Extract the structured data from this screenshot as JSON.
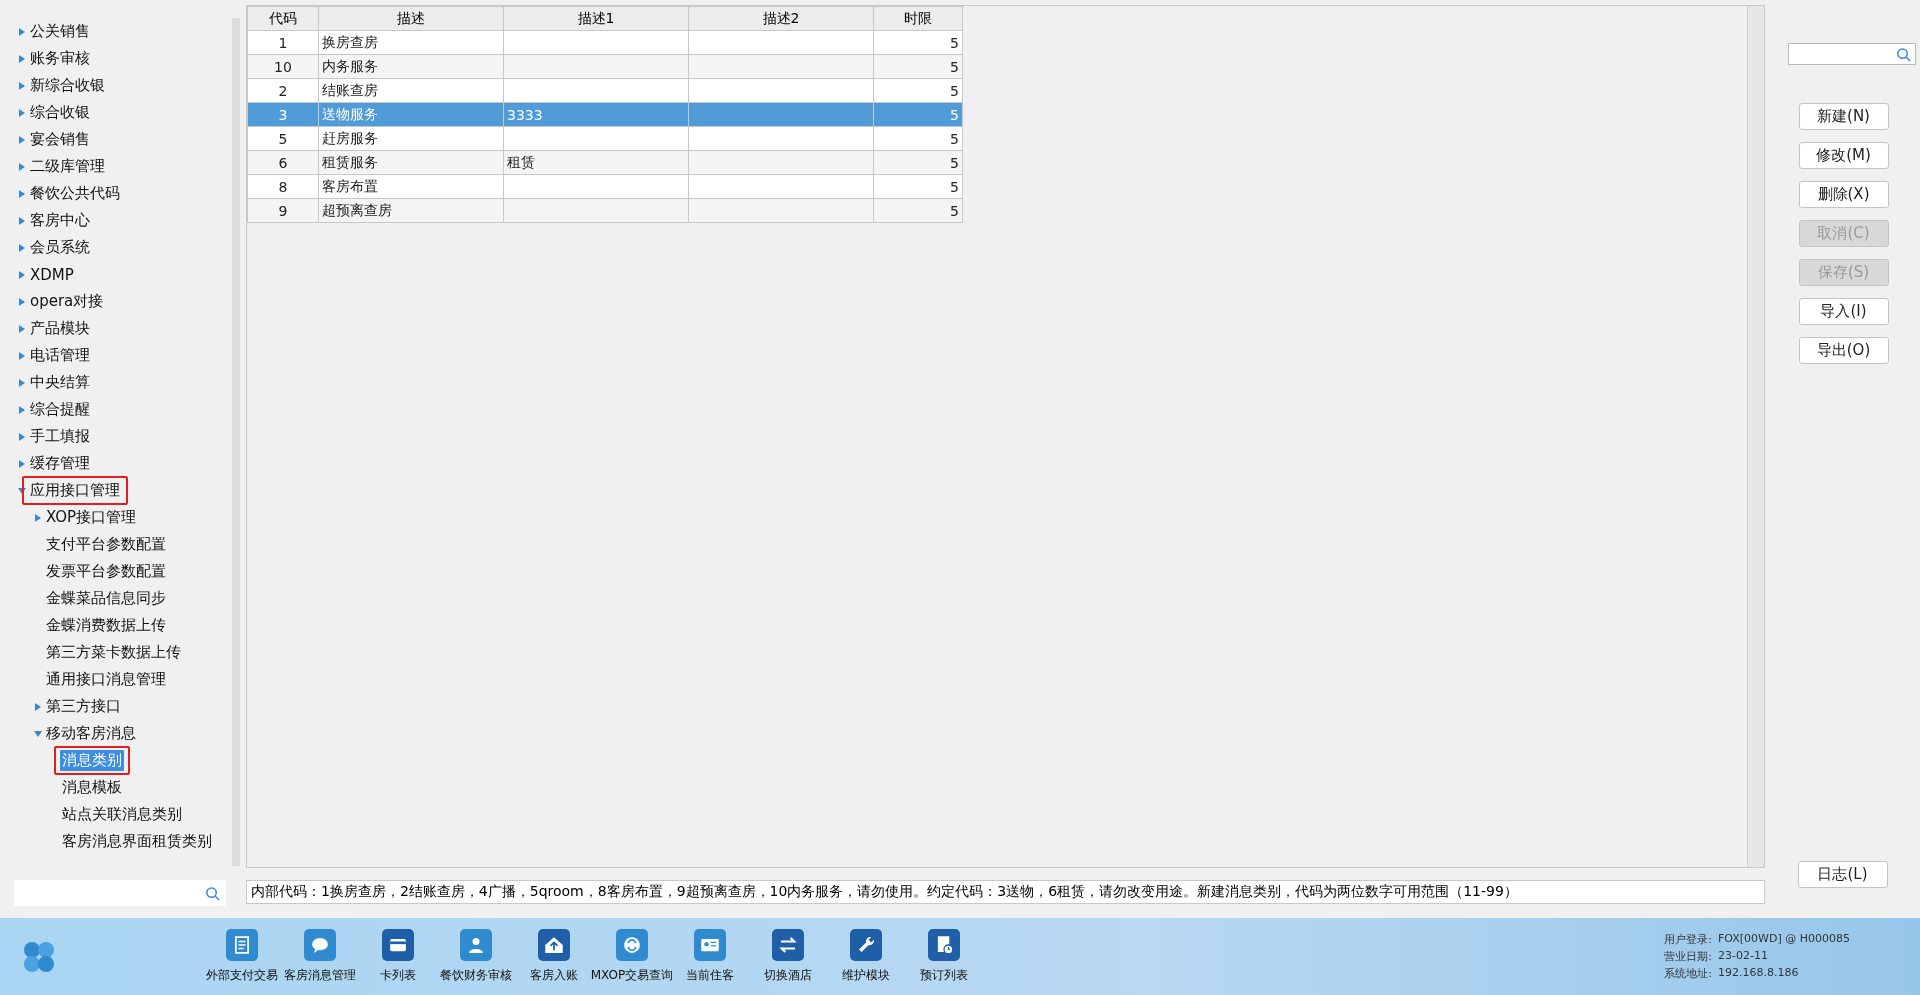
{
  "sidebar": {
    "items": [
      {
        "label": "公关销售",
        "expanded": false,
        "selected": false
      },
      {
        "label": "账务审核",
        "expanded": false,
        "selected": false
      },
      {
        "label": "新综合收银",
        "expanded": false,
        "selected": false
      },
      {
        "label": "综合收银",
        "expanded": false,
        "selected": false
      },
      {
        "label": "宴会销售",
        "expanded": false,
        "selected": false
      },
      {
        "label": "二级库管理",
        "expanded": false,
        "selected": false
      },
      {
        "label": "餐饮公共代码",
        "expanded": false,
        "selected": false
      },
      {
        "label": "客房中心",
        "expanded": false,
        "selected": false
      },
      {
        "label": "会员系统",
        "expanded": false,
        "selected": false
      },
      {
        "label": "XDMP",
        "expanded": false,
        "selected": false
      },
      {
        "label": "opera对接",
        "expanded": false,
        "selected": false
      },
      {
        "label": "产品模块",
        "expanded": false,
        "selected": false
      },
      {
        "label": "电话管理",
        "expanded": false,
        "selected": false
      },
      {
        "label": "中央结算",
        "expanded": false,
        "selected": false
      },
      {
        "label": "综合提醒",
        "expanded": false,
        "selected": false
      },
      {
        "label": "手工填报",
        "expanded": false,
        "selected": false
      },
      {
        "label": "缓存管理",
        "expanded": false,
        "selected": false
      },
      {
        "label": "应用接口管理",
        "expanded": true,
        "selected": false,
        "annotated": true,
        "children": [
          {
            "label": "XOP接口管理",
            "expanded": false,
            "selected": false
          },
          {
            "label": "支付平台参数配置",
            "selected": false
          },
          {
            "label": "发票平台参数配置",
            "selected": false
          },
          {
            "label": "金蝶菜品信息同步",
            "selected": false
          },
          {
            "label": "金蝶消费数据上传",
            "selected": false
          },
          {
            "label": "第三方菜卡数据上传",
            "selected": false
          },
          {
            "label": "通用接口消息管理",
            "selected": false
          },
          {
            "label": "第三方接口",
            "expanded": false,
            "selected": false
          },
          {
            "label": "移动客房消息",
            "expanded": true,
            "selected": false,
            "children": [
              {
                "label": "消息类别",
                "selected": true,
                "annotated": true
              },
              {
                "label": "消息模板",
                "selected": false
              },
              {
                "label": "站点关联消息类别",
                "selected": false
              },
              {
                "label": "客房消息界面租赁类别",
                "selected": false
              }
            ]
          }
        ]
      }
    ]
  },
  "table": {
    "columns": [
      "代码",
      "描述",
      "描述1",
      "描述2",
      "时限"
    ],
    "rows": [
      {
        "code": "1",
        "desc": "换房查房",
        "limit": "5",
        "selected": false
      },
      {
        "code": "10",
        "desc": "内务服务",
        "limit": "5",
        "selected": false
      },
      {
        "code": "2",
        "desc": "结账查房",
        "limit": "5",
        "selected": false
      },
      {
        "code": "3",
        "desc": "送物服务",
        "desc1": "3333",
        "limit": "5",
        "selected": true
      },
      {
        "code": "5",
        "desc": "赶房服务",
        "limit": "5",
        "selected": false
      },
      {
        "code": "6",
        "desc": "租赁服务",
        "desc1": "租赁",
        "limit": "5",
        "selected": false
      },
      {
        "code": "8",
        "desc": "客房布置",
        "limit": "5",
        "selected": false
      },
      {
        "code": "9",
        "desc": "超预离查房",
        "limit": "5",
        "selected": false
      }
    ]
  },
  "note": "内部代码：1换房查房，2结账查房，4广播，5qroom，8客房布置，9超预离查房，10内务服务，请勿使用。约定代码：3送物，6租赁，请勿改变用途。新建消息类别，代码为两位数字可用范围（11-99）",
  "actions": [
    {
      "label": "新建(N)",
      "disabled": false
    },
    {
      "label": "修改(M)",
      "disabled": false
    },
    {
      "label": "删除(X)",
      "disabled": false
    },
    {
      "label": "取消(C)",
      "disabled": true
    },
    {
      "label": "保存(S)",
      "disabled": true
    },
    {
      "label": "导入(I)",
      "disabled": false
    },
    {
      "label": "导出(O)",
      "disabled": false
    }
  ],
  "log_button": "日志(L)",
  "taskbar": {
    "apps": [
      {
        "kind": "doc",
        "label": "外部支付交易"
      },
      {
        "kind": "chat",
        "label": "客房消息管理"
      },
      {
        "kind": "card",
        "label": "卡列表"
      },
      {
        "kind": "person",
        "label": "餐饮财务审核"
      },
      {
        "kind": "house",
        "label": "客房入账"
      },
      {
        "kind": "sync",
        "label": "MXOP交易查询"
      },
      {
        "kind": "idcard",
        "label": "当前住客"
      },
      {
        "kind": "swap",
        "label": "切换酒店"
      },
      {
        "kind": "wrench",
        "label": "维护模块"
      },
      {
        "kind": "clockdoc",
        "label": "预订列表"
      }
    ],
    "info": [
      {
        "label": "用户登录:",
        "value": "FOX[00WD] @ H000085"
      },
      {
        "label": "营业日期:",
        "value": "23-02-11"
      },
      {
        "label": "系统地址:",
        "value": "192.168.8.186"
      }
    ]
  }
}
